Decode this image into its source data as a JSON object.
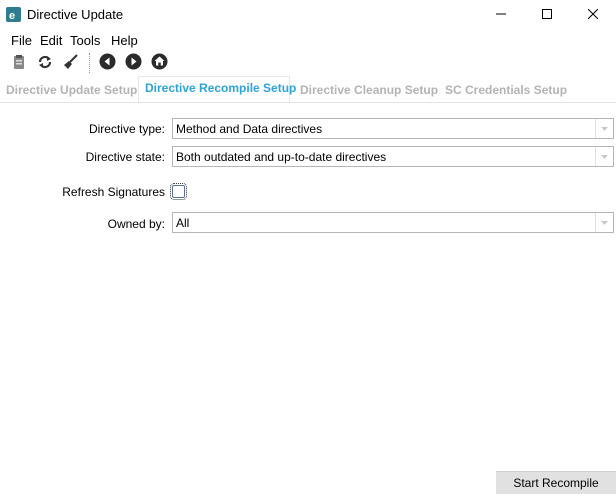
{
  "window": {
    "title": "Directive Update",
    "app_icon": "directive-app-icon",
    "controls": [
      "minimize-icon",
      "maximize-icon",
      "close-icon"
    ]
  },
  "menu": [
    "File",
    "Edit",
    "Tools",
    "Help"
  ],
  "toolbar": [
    "clipboard-icon",
    "refresh-icon",
    "broom-icon",
    "back-icon",
    "forward-icon",
    "home-icon"
  ],
  "tabs": [
    {
      "label": "Directive Update Setup",
      "active": false
    },
    {
      "label": "Directive Recompile Setup",
      "active": true
    },
    {
      "label": "Directive Cleanup Setup",
      "active": false
    },
    {
      "label": "SC Credentials Setup",
      "active": false
    }
  ],
  "form": {
    "directive_type": {
      "label": "Directive type:",
      "value": "Method and Data directives"
    },
    "directive_state": {
      "label": "Directive state:",
      "value": "Both outdated and up-to-date directives"
    },
    "refresh_signatures": {
      "label": "Refresh Signatures",
      "checked": false
    },
    "owned_by": {
      "label": "Owned by:",
      "value": "All"
    }
  },
  "actions": {
    "start_recompile": "Start Recompile"
  },
  "colors": {
    "active_tab": "#2fa3d6",
    "inactive_tab": "#b3b3b3",
    "app_icon": "#2e7d8e"
  }
}
